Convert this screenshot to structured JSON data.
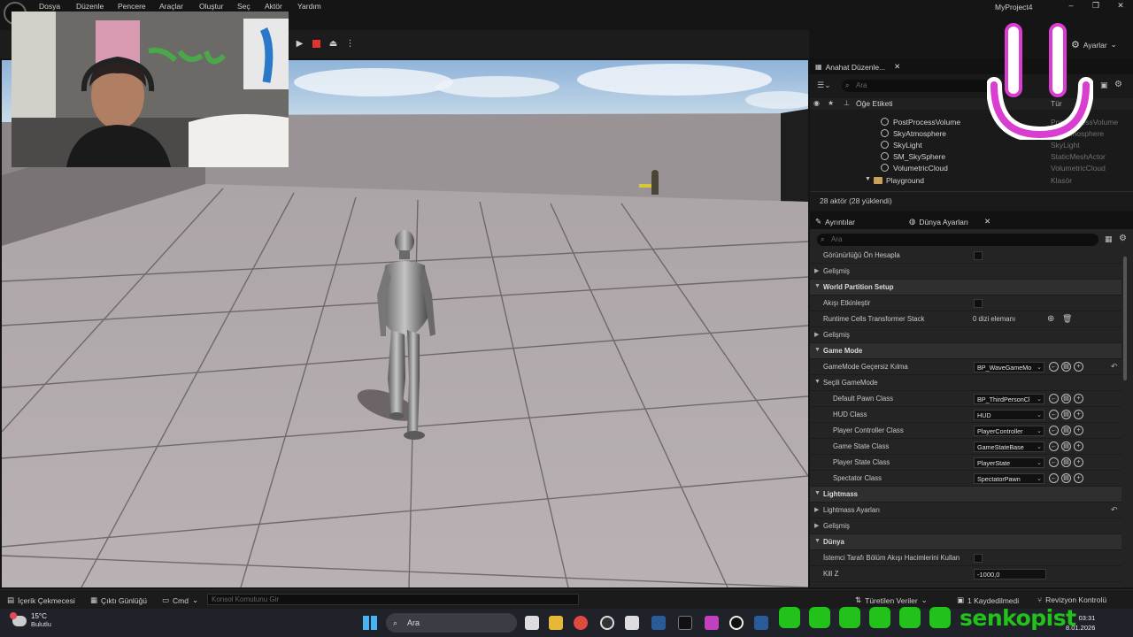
{
  "menubar": {
    "items": [
      "Dosya",
      "Düzenle",
      "Pencere",
      "Araçlar",
      "Oluştur",
      "Seç",
      "Aktör",
      "Yardım"
    ],
    "project_title": "MyProject4"
  },
  "toolbar": {
    "settings_label": "Ayarlar"
  },
  "outliner": {
    "tab_label": "Anahat Düzenle...",
    "search_placeholder": "Ara",
    "col_label": "Öğe Etiketi",
    "col_type": "Tür",
    "rows": [
      {
        "name": "PostProcessVolume",
        "type": "PostProcessVolume"
      },
      {
        "name": "SkyAtmosphere",
        "type": "SkyAtmosphere"
      },
      {
        "name": "SkyLight",
        "type": "SkyLight"
      },
      {
        "name": "SM_SkySphere",
        "type": "StaticMeshActor"
      },
      {
        "name": "VolumetricCloud",
        "type": "VolumetricCloud"
      },
      {
        "name": "Playground",
        "type": "Klasör"
      }
    ],
    "status": "28 aktör (28 yüklendi)"
  },
  "details": {
    "tab_details": "Ayrıntılar",
    "tab_world": "Dünya Ayarları",
    "search_placeholder": "Ara",
    "rows": {
      "r0": "Görünürlüğü Ön Hesapla",
      "r1": "Gelişmiş",
      "r2": "World Partition Setup",
      "r3": "Akışı Etkinleştir",
      "r4": "Runtime Cells Transformer Stack",
      "r4_val": "0 dizi elemanı",
      "r5": "Gelişmiş",
      "r6": "Game Mode",
      "r7": "GameMode Geçersiz Kılma",
      "r7_val": "BP_WaveGameMo",
      "r8": "Seçili GameMode",
      "r9": "Default Pawn Class",
      "r9_val": "BP_ThirdPersonCl",
      "r10": "HUD Class",
      "r10_val": "HUD",
      "r11": "Player Controller Class",
      "r11_val": "PlayerController",
      "r12": "Game State Class",
      "r12_val": "GameStateBase",
      "r13": "Player State Class",
      "r13_val": "PlayerState",
      "r14": "Spectator Class",
      "r14_val": "SpectatorPawn",
      "r15": "Lightmass",
      "r16": "Lightmass Ayarları",
      "r17": "Gelişmiş",
      "r18": "Dünya",
      "r19": "İstemci Tarafı Bölüm Akışı Hacimlerini Kullan",
      "r20": "Kill Z",
      "r20_val": "-1000,0"
    }
  },
  "bottombar": {
    "content_drawer": "İçerik Çekmecesi",
    "output_log": "Çıktı Günlüğü",
    "cmd": "Cmd",
    "console_placeholder": "Konsol Komutunu Gir",
    "derived_data": "Türetilen Veriler",
    "saved": "1 Kaydedilmedi",
    "revision": "Revizyon Kontrolü"
  },
  "taskbar": {
    "temperature": "15°C",
    "weather": "Bulutlu",
    "search": "Ara",
    "time": "03:31",
    "date": "8.01.2026"
  },
  "overlay": {
    "handle": "senkopist"
  }
}
